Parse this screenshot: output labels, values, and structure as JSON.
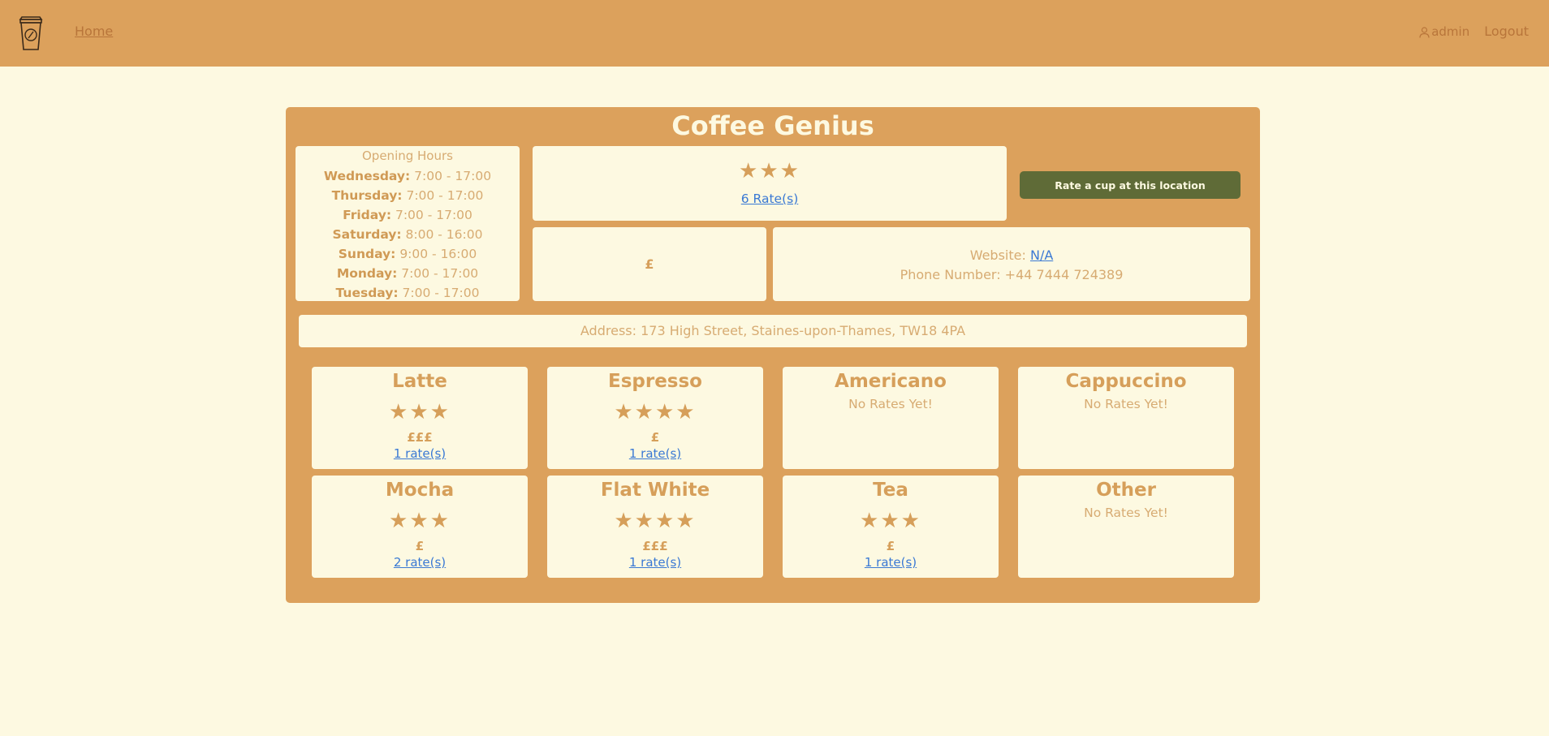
{
  "nav": {
    "home": "Home",
    "user": "admin",
    "logout": "Logout"
  },
  "shop": {
    "title": "Coffee Genius",
    "hours_title": "Opening Hours",
    "hours": [
      {
        "day": "Wednesday:",
        "time": "7:00 - 17:00"
      },
      {
        "day": "Thursday:",
        "time": "7:00 - 17:00"
      },
      {
        "day": "Friday:",
        "time": "7:00 - 17:00"
      },
      {
        "day": "Saturday:",
        "time": "8:00 - 16:00"
      },
      {
        "day": "Sunday:",
        "time": "9:00 - 16:00"
      },
      {
        "day": "Monday:",
        "time": "7:00 - 17:00"
      },
      {
        "day": "Tuesday:",
        "time": "7:00 - 17:00"
      }
    ],
    "stars": "★★★",
    "rate_count": "6 Rate(s)",
    "rate_button": "Rate a cup at this location",
    "price": "£",
    "website_label": "Website:",
    "website_value": "N/A",
    "phone": "Phone Number: +44 7444 724389",
    "address": "Address: 173 High Street, Staines-upon-Thames, TW18 4PA"
  },
  "drinks": [
    {
      "name": "Latte",
      "stars": "★★★",
      "price": "£££",
      "rates": "1 rate(s)"
    },
    {
      "name": "Espresso",
      "stars": "★★★★",
      "price": "£",
      "rates": "1 rate(s)"
    },
    {
      "name": "Americano",
      "none": "No Rates Yet!"
    },
    {
      "name": "Cappuccino",
      "none": "No Rates Yet!"
    },
    {
      "name": "Mocha",
      "stars": "★★★",
      "price": "£",
      "rates": "2 rate(s)"
    },
    {
      "name": "Flat White",
      "stars": "★★★★",
      "price": "£££",
      "rates": "1 rate(s)"
    },
    {
      "name": "Tea",
      "stars": "★★★",
      "price": "£",
      "rates": "1 rate(s)"
    },
    {
      "name": "Other",
      "none": "No Rates Yet!"
    }
  ],
  "colors": {
    "navbar": "#dca15c",
    "background": "#fdf9e1",
    "accent": "#d69f5a",
    "button": "#5f6b37",
    "link": "#3a79d4"
  }
}
